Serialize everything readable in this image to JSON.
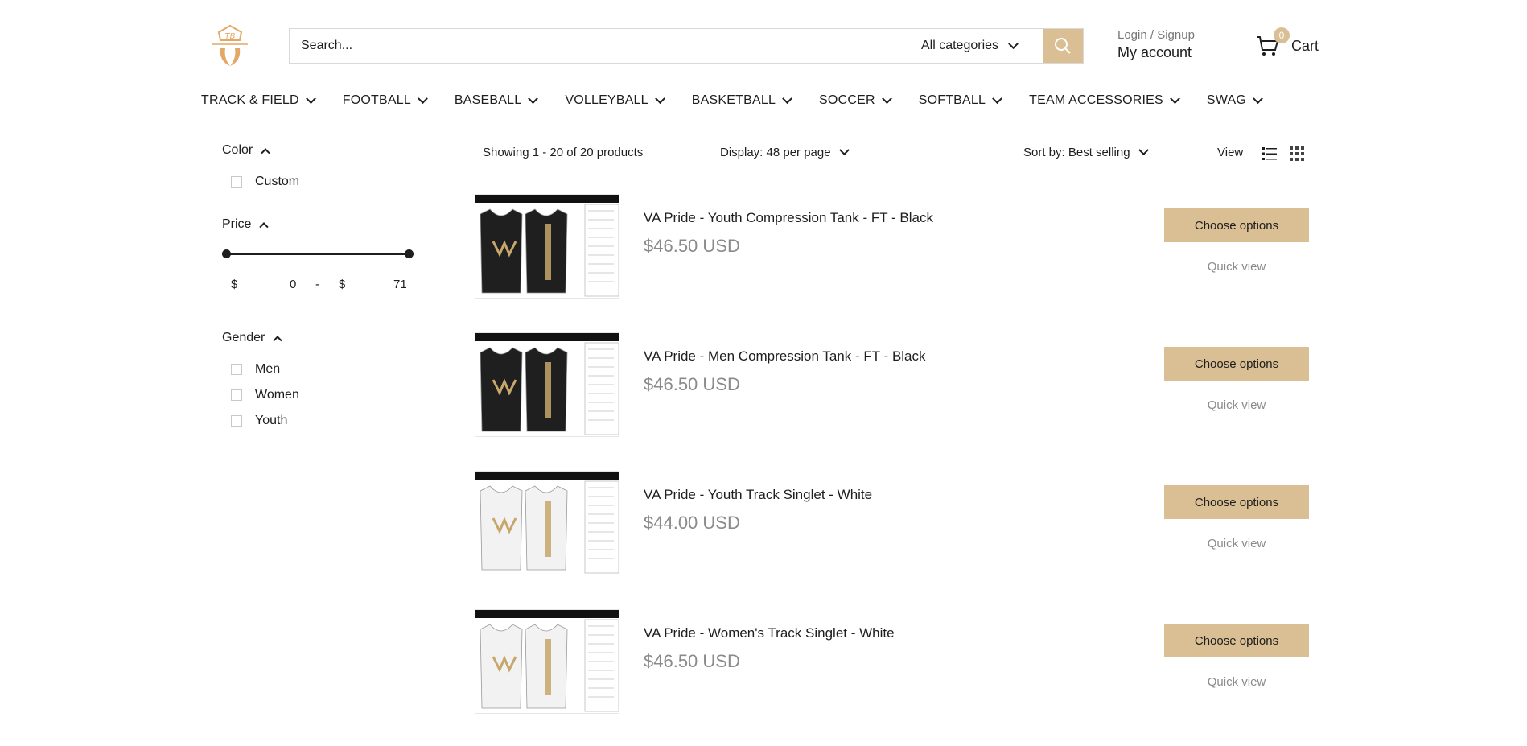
{
  "header": {
    "search_placeholder": "Search...",
    "category_select": "All categories",
    "login_label": "Login / Signup",
    "account_label": "My account",
    "cart_count": "0",
    "cart_label": "Cart"
  },
  "nav": {
    "items": [
      "TRACK & FIELD",
      "FOOTBALL",
      "BASEBALL",
      "VOLLEYBALL",
      "BASKETBALL",
      "SOCCER",
      "SOFTBALL",
      "TEAM ACCESSORIES",
      "SWAG"
    ]
  },
  "filters": {
    "color": {
      "title": "Color",
      "options": [
        "Custom"
      ]
    },
    "price": {
      "title": "Price",
      "currency": "$",
      "min": "0",
      "separator": "-",
      "max": "71"
    },
    "gender": {
      "title": "Gender",
      "options": [
        "Men",
        "Women",
        "Youth"
      ]
    }
  },
  "toolbar": {
    "showing": "Showing 1 - 20 of 20 products",
    "display": "Display: 48 per page",
    "sort": "Sort by: Best selling",
    "view_label": "View"
  },
  "products": [
    {
      "title": "VA Pride - Youth Compression Tank - FT - Black",
      "price": "$46.50 USD",
      "button": "Choose options",
      "quick_view": "Quick view",
      "color": "#1f1f1f"
    },
    {
      "title": "VA Pride - Men Compression Tank - FT - Black",
      "price": "$46.50 USD",
      "button": "Choose options",
      "quick_view": "Quick view",
      "color": "#1f1f1f"
    },
    {
      "title": "VA Pride - Youth Track Singlet - White",
      "price": "$44.00 USD",
      "button": "Choose options",
      "quick_view": "Quick view",
      "color": "#f2f2f2"
    },
    {
      "title": "VA Pride - Women's Track Singlet - White",
      "price": "$46.50 USD",
      "button": "Choose options",
      "quick_view": "Quick view",
      "color": "#f2f2f2"
    }
  ],
  "colors": {
    "accent": "#d9bf93",
    "logo": "#e3a866"
  }
}
